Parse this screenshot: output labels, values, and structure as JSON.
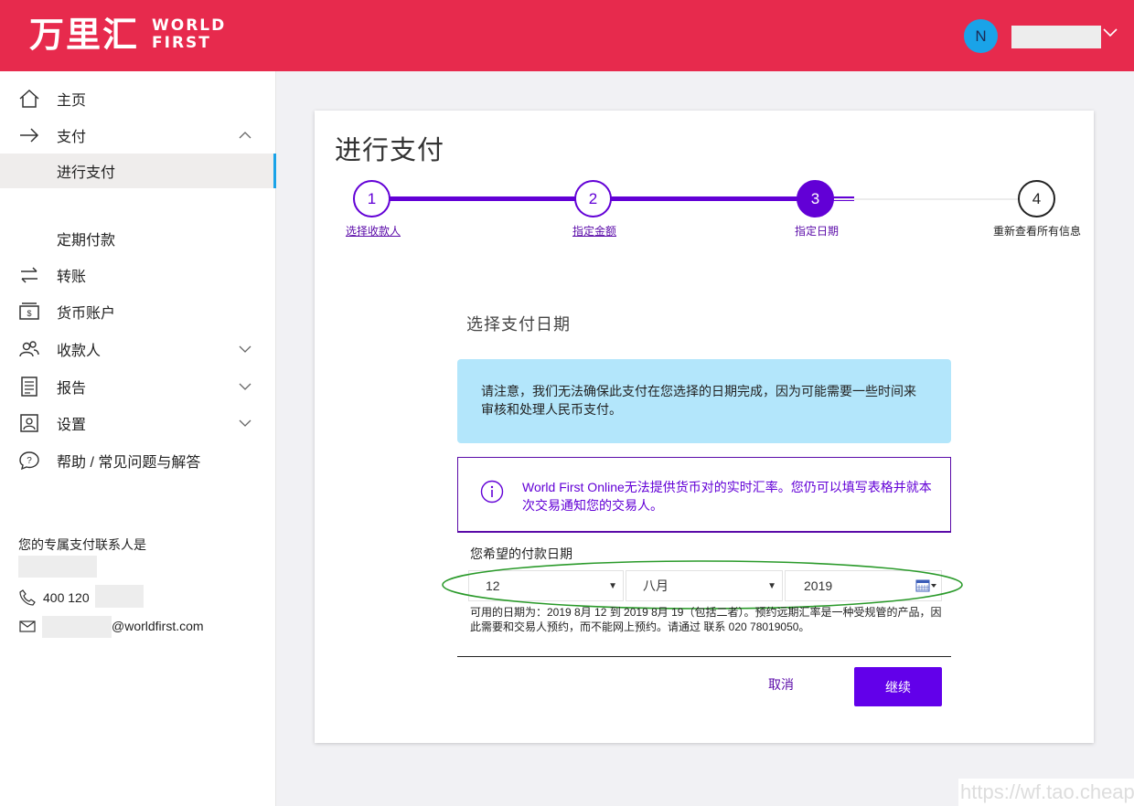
{
  "header": {
    "logo_cn": "万里汇",
    "logo_en_1": "WORLD",
    "logo_en_2": "FIRST",
    "avatar_initial": "N"
  },
  "sidebar": {
    "items": [
      {
        "label": "主页",
        "icon": "home-icon"
      },
      {
        "label": "支付",
        "icon": "arrow-right-icon"
      },
      {
        "label": "进行支付"
      },
      {
        "label": "定期付款"
      },
      {
        "label": "转账",
        "icon": "transfer-icon"
      },
      {
        "label": "货币账户",
        "icon": "wallet-icon"
      },
      {
        "label": "收款人",
        "icon": "recipients-icon"
      },
      {
        "label": "报告",
        "icon": "report-icon"
      },
      {
        "label": "设置",
        "icon": "settings-icon"
      },
      {
        "label": "帮助 / 常见问题与解答",
        "icon": "help-icon"
      }
    ],
    "contact": {
      "title": "您的专属支付联系人是",
      "phone_prefix": "400 120",
      "email_suffix": "@worldfirst.com"
    }
  },
  "main": {
    "title": "进行支付",
    "steps": [
      {
        "number": "1",
        "label": "选择收款人"
      },
      {
        "number": "2",
        "label": "指定金额"
      },
      {
        "number": "3",
        "label": "指定日期"
      },
      {
        "number": "4",
        "label": "重新查看所有信息"
      }
    ],
    "section_title": "选择支付日期",
    "notice": "请注意，我们无法确保此支付在您选择的日期完成，因为可能需要一些时间来审核和处理人民币支付。",
    "rate_notice": "World First Online无法提供货币对的实时汇率。您仍可以填写表格并就本次交易通知您的交易人。",
    "date_label": "您希望的付款日期",
    "day_value": "12",
    "month_value": "八月",
    "year_value": "2019",
    "hint": "可用的日期为：2019 8月 12 到 2019 8月 19（包括二者）。预约远期汇率是一种受规管的产品，因此需要和交易人预约，而不能网上预约。请通过 联系 020 78019050。",
    "cancel_label": "取消",
    "continue_label": "继续"
  },
  "watermark": "https://wf.tao.cheap",
  "colors": {
    "header": "#e72a4d",
    "accent": "#6200d6",
    "notice_bg": "#b3e6fb",
    "avatar": "#1aa3e8",
    "highlight": "#2a9a2a"
  }
}
